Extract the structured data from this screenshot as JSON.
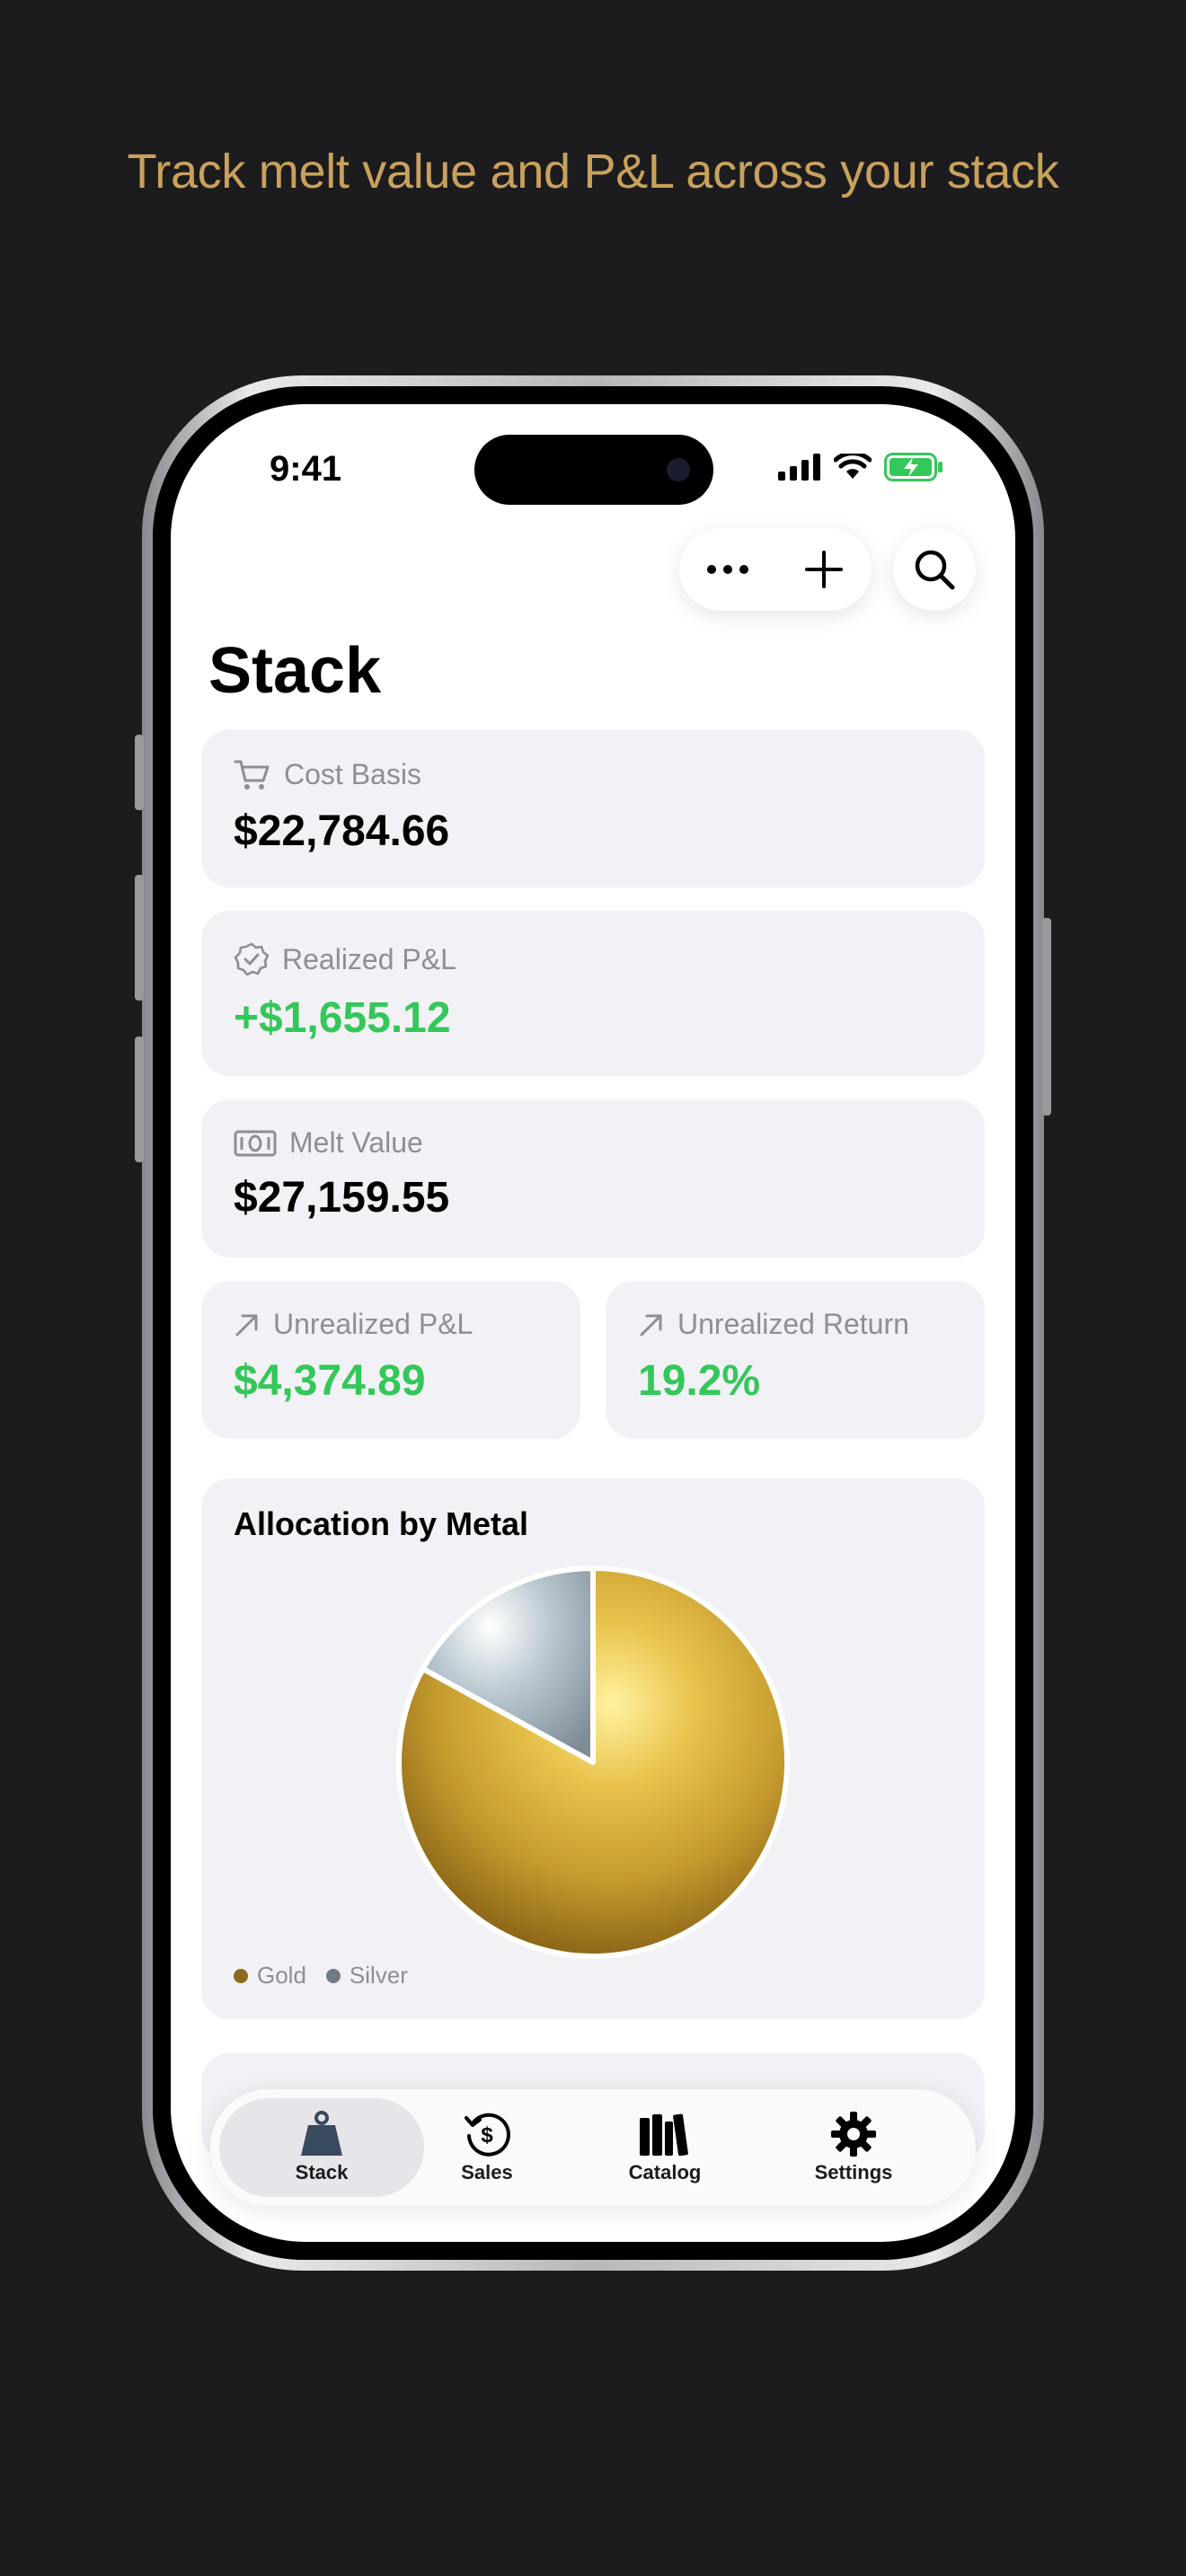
{
  "headline": "Track melt value and P&L across your stack",
  "status": {
    "time": "9:41"
  },
  "toolbar": {
    "more_icon": "ellipsis-icon",
    "add_icon": "plus-icon",
    "search_icon": "search-icon"
  },
  "page": {
    "title": "Stack"
  },
  "cards": {
    "cost_basis": {
      "label": "Cost Basis",
      "value": "$22,784.66",
      "icon": "cart-icon"
    },
    "realized_pl": {
      "label": "Realized P&L",
      "value": "+$1,655.12",
      "icon": "seal-check-icon"
    },
    "melt_value": {
      "label": "Melt Value",
      "value": "$27,159.55",
      "icon": "banknote-icon"
    },
    "unrealized_pl": {
      "label": "Unrealized P&L",
      "value": "$4,374.89",
      "icon": "arrow-up-right-icon"
    },
    "unrealized_return": {
      "label": "Unrealized Return",
      "value": "19.2%",
      "icon": "arrow-up-right-icon"
    }
  },
  "allocation": {
    "title": "Allocation by Metal",
    "legend": [
      {
        "label": "Gold",
        "color": "#8c6a1e"
      },
      {
        "label": "Silver",
        "color": "#6e7b84"
      }
    ]
  },
  "chart_data": {
    "type": "pie",
    "title": "Allocation by Metal",
    "categories": [
      "Gold",
      "Silver"
    ],
    "values": [
      83,
      17
    ],
    "colors": [
      "#c9a13a",
      "#b9c6cf"
    ],
    "legend_position": "bottom-left"
  },
  "tabs": [
    {
      "label": "Stack",
      "icon": "weight-icon",
      "active": true
    },
    {
      "label": "Sales",
      "icon": "dollar-refresh-icon",
      "active": false
    },
    {
      "label": "Catalog",
      "icon": "books-icon",
      "active": false
    },
    {
      "label": "Settings",
      "icon": "gear-icon",
      "active": false
    }
  ]
}
